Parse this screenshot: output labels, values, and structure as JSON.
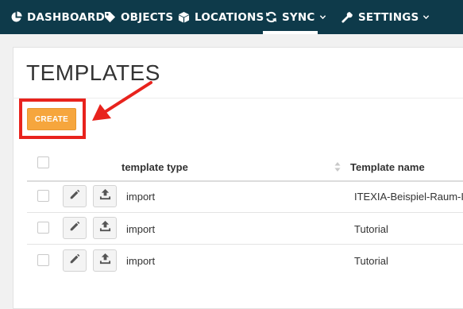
{
  "nav": {
    "items": [
      {
        "label": "DASHBOARD",
        "icon": "pie-chart-icon"
      },
      {
        "label": "OBJECTS",
        "icon": "tag-icon"
      },
      {
        "label": "LOCATIONS",
        "icon": "cube-icon"
      },
      {
        "label": "SYNC",
        "icon": "sync-icon",
        "active": true,
        "dropdown": true
      },
      {
        "label": "SETTINGS",
        "icon": "wrench-icon",
        "dropdown": true
      }
    ]
  },
  "page": {
    "title": "TEMPLATES",
    "create_label": "CREATE"
  },
  "table": {
    "headers": {
      "type": "template type",
      "name": "Template name"
    },
    "rows": [
      {
        "type": "import",
        "name": "ITEXIA-Beispiel-Raum-Im"
      },
      {
        "type": "import",
        "name": "Tutorial"
      },
      {
        "type": "import",
        "name": "Tutorial"
      }
    ]
  },
  "colors": {
    "nav_bg": "#0e3a4a",
    "create_button": "#f6a63d",
    "annotation_red": "#e8231d"
  }
}
